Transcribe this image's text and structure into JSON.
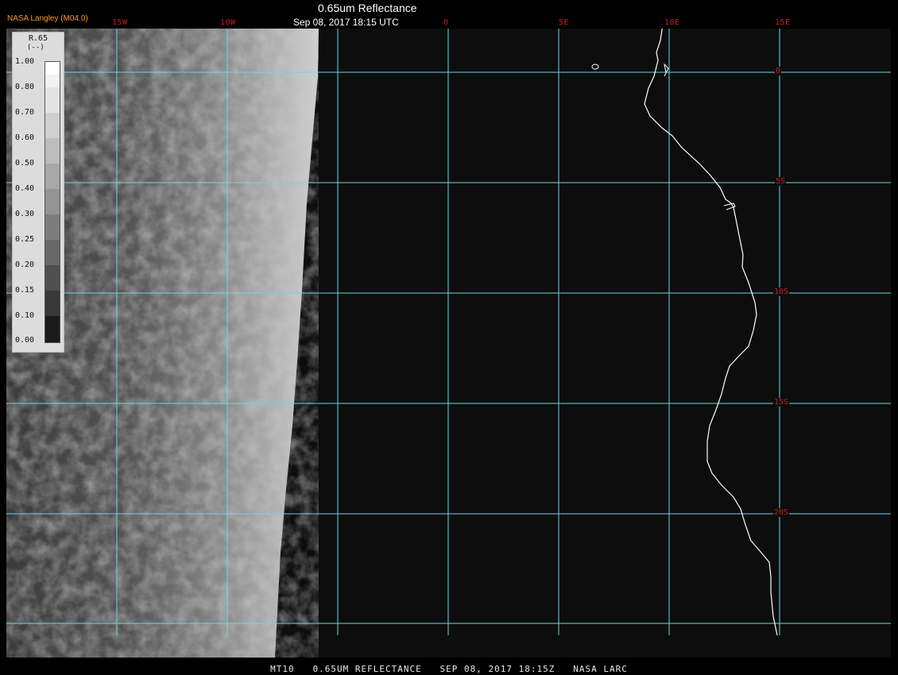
{
  "header": {
    "title": "0.65um Reflectance",
    "datetime": "Sep 08, 2017 18:15 UTC",
    "brand": "NASA Langley (M04.0)"
  },
  "lon_labels": [
    "15W",
    "10W",
    "0",
    "5E",
    "10E",
    "15E"
  ],
  "lat_labels": [
    "0",
    "5S",
    "10S",
    "15S",
    "20S"
  ],
  "legend": {
    "title": "R.65",
    "unit": "(--)",
    "ticks": [
      "1.00",
      "0.80",
      "0.70",
      "0.60",
      "0.50",
      "0.40",
      "0.30",
      "0.25",
      "0.20",
      "0.15",
      "0.10",
      "0.00"
    ]
  },
  "footer": "MT10   0.65UM REFLECTANCE   SEP 08, 2017 18:15Z   NASA LARC",
  "colors": {
    "grid": "#66d9e8",
    "labels": "#cc1a1a",
    "brand": "#ff9a1a",
    "coast": "#ffffff"
  }
}
